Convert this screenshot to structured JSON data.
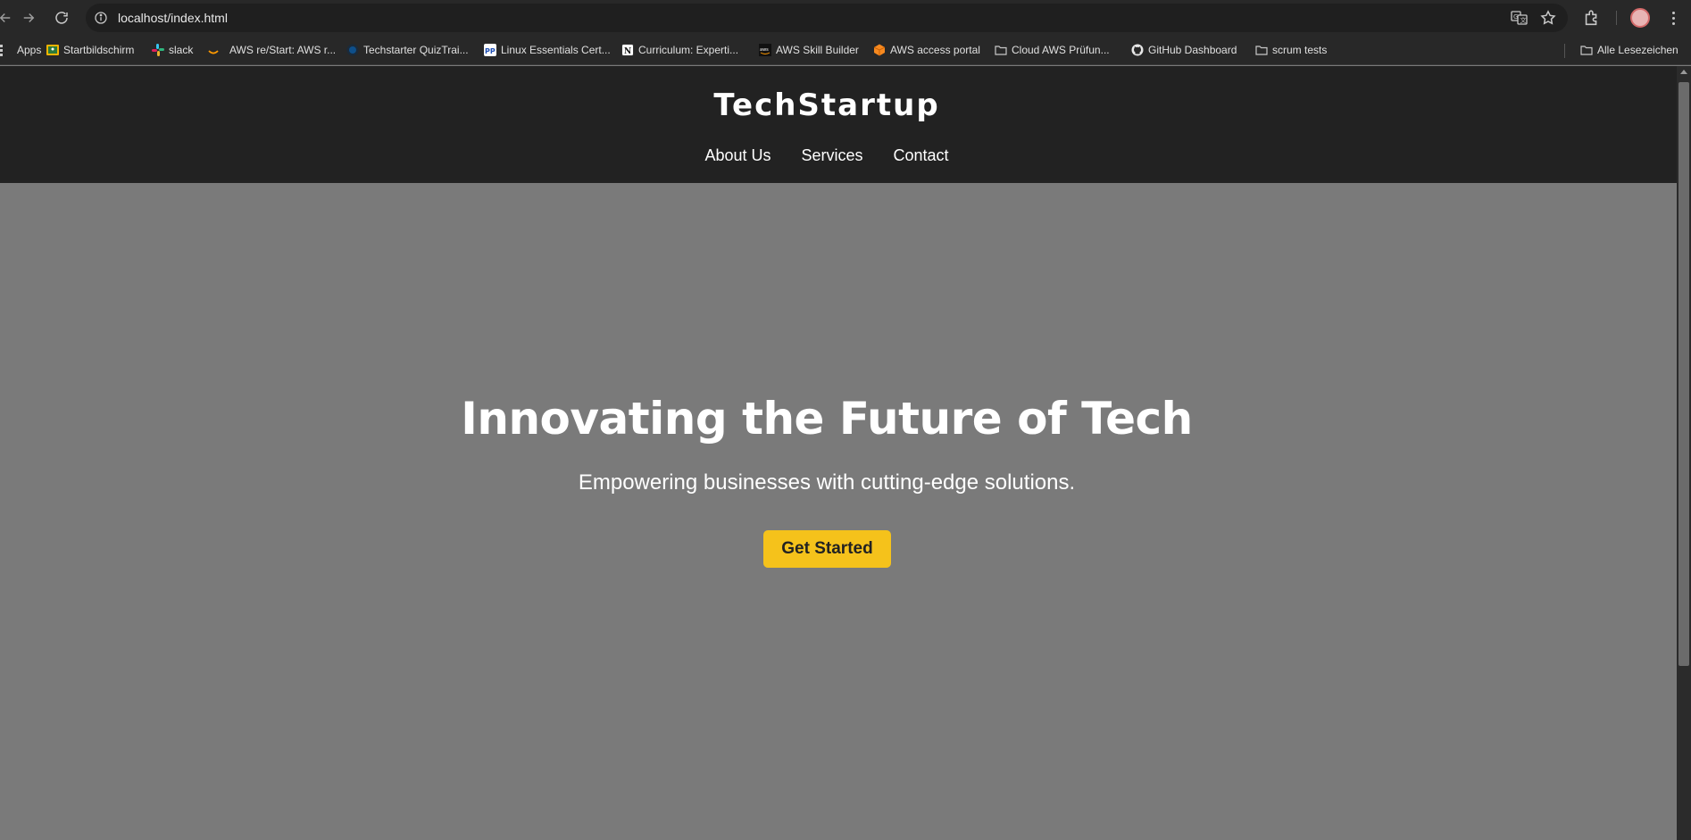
{
  "browser": {
    "url": "localhost/index.html",
    "nav_icons": [
      "back-icon",
      "forward-icon",
      "reload-icon"
    ],
    "omnibox_icons": [
      "site-info-icon",
      "translate-icon",
      "bookmark-star-icon"
    ],
    "toolbar_icons": [
      "extensions-icon",
      "profile-avatar",
      "more-menu-icon"
    ]
  },
  "bookmarks": {
    "items": [
      {
        "label": "Apps",
        "icon": "apps-grid-icon"
      },
      {
        "label": "Startbildschirm",
        "icon": "google-classroom-icon"
      },
      {
        "label": "slack",
        "icon": "slack-icon"
      },
      {
        "label": "AWS re/Start: AWS r...",
        "icon": "aws-restart-icon"
      },
      {
        "label": "Techstarter QuizTrai...",
        "icon": "techstarter-icon"
      },
      {
        "label": "Linux Essentials Cert...",
        "icon": "pp-icon"
      },
      {
        "label": "Curriculum: Experti...",
        "icon": "notion-icon"
      },
      {
        "label": "AWS Skill Builder",
        "icon": "aws-icon"
      },
      {
        "label": "AWS access portal",
        "icon": "aws-cube-icon"
      },
      {
        "label": "Cloud AWS Prüfun...",
        "icon": "folder-icon"
      },
      {
        "label": "GitHub Dashboard",
        "icon": "github-icon"
      },
      {
        "label": "scrum tests",
        "icon": "folder-icon"
      }
    ],
    "all_bookmarks": {
      "label": "Alle Lesezeichen",
      "icon": "folder-icon"
    }
  },
  "site": {
    "logo": "TechStartup",
    "nav": [
      "About Us",
      "Services",
      "Contact"
    ]
  },
  "hero": {
    "title": "Innovating the Future of Tech",
    "subtitle": "Empowering businesses with cutting-edge solutions.",
    "cta_label": "Get Started"
  },
  "colors": {
    "header_bg": "#222222",
    "hero_bg": "#7a7a7a",
    "cta_bg": "#f5c21b",
    "cta_text": "#222222",
    "browser_chrome": "#282828"
  }
}
